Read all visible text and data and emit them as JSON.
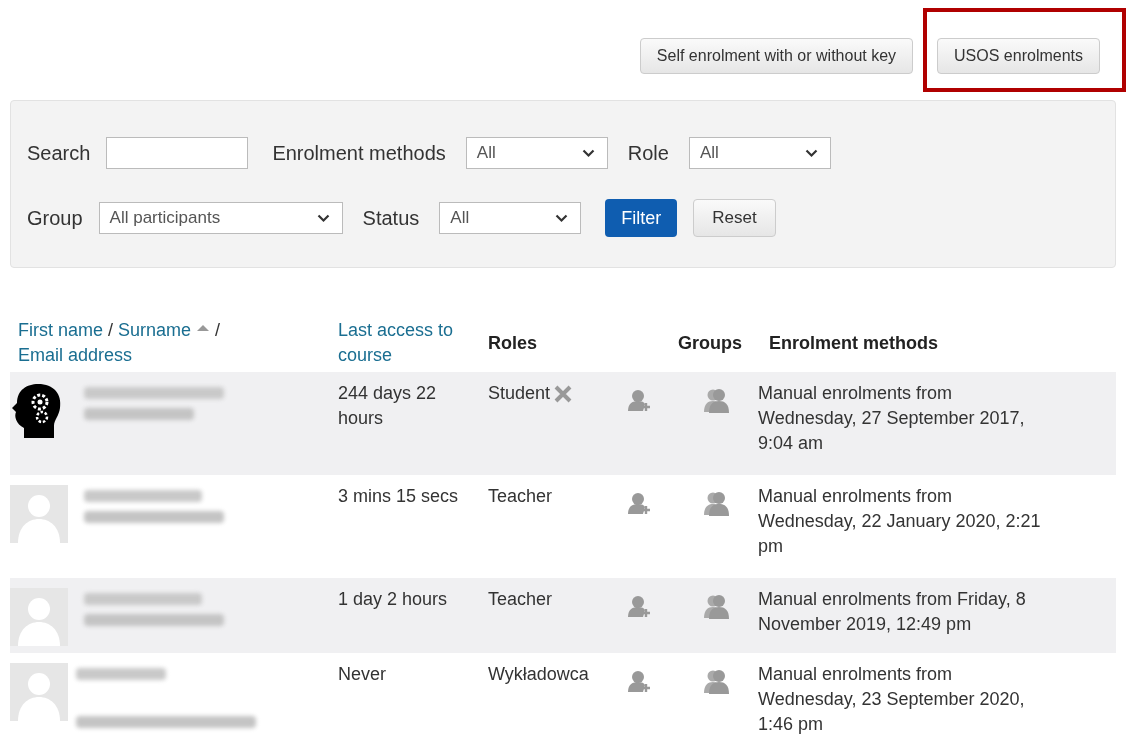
{
  "top_buttons": [
    {
      "label": "Self enrolment with or without key",
      "highlighted": false
    },
    {
      "label": "USOS enrolments",
      "highlighted": true
    }
  ],
  "filters": {
    "search": {
      "label": "Search"
    },
    "enrolment_methods": {
      "label": "Enrolment methods",
      "value": "All"
    },
    "role": {
      "label": "Role",
      "value": "All"
    },
    "group": {
      "label": "Group",
      "value": "All participants"
    },
    "status": {
      "label": "Status",
      "value": "All"
    },
    "filter_button": "Filter",
    "reset_button": "Reset"
  },
  "table": {
    "header": {
      "name_links": [
        "First name",
        "Surname",
        "Email address"
      ],
      "separator": "/",
      "last_access": "Last access to course",
      "roles": "Roles",
      "groups": "Groups",
      "enrolment_methods": "Enrolment methods"
    },
    "rows": [
      {
        "avatar": {
          "kind": "custom"
        },
        "last_access": "244 days 22 hours",
        "role": "Student",
        "role_removable": true,
        "enrolment": "Manual enrolments from Wednesday, 27 September 2017, 9:04 am"
      },
      {
        "avatar": {
          "kind": "default"
        },
        "last_access": "3 mins 15 secs",
        "role": "Teacher",
        "role_removable": false,
        "enrolment": "Manual enrolments from Wednesday, 22 January 2020, 2:21 pm"
      },
      {
        "avatar": {
          "kind": "default"
        },
        "last_access": "1 day 2 hours",
        "role": "Teacher",
        "role_removable": false,
        "enrolment": "Manual enrolments from Friday, 8 November 2019, 12:49 pm"
      },
      {
        "avatar": {
          "kind": "default"
        },
        "last_access": "Never",
        "role": "Wykładowca",
        "role_removable": false,
        "enrolment": "Manual enrolments from Wednesday, 23 September 2020, 1:46 pm"
      }
    ]
  }
}
